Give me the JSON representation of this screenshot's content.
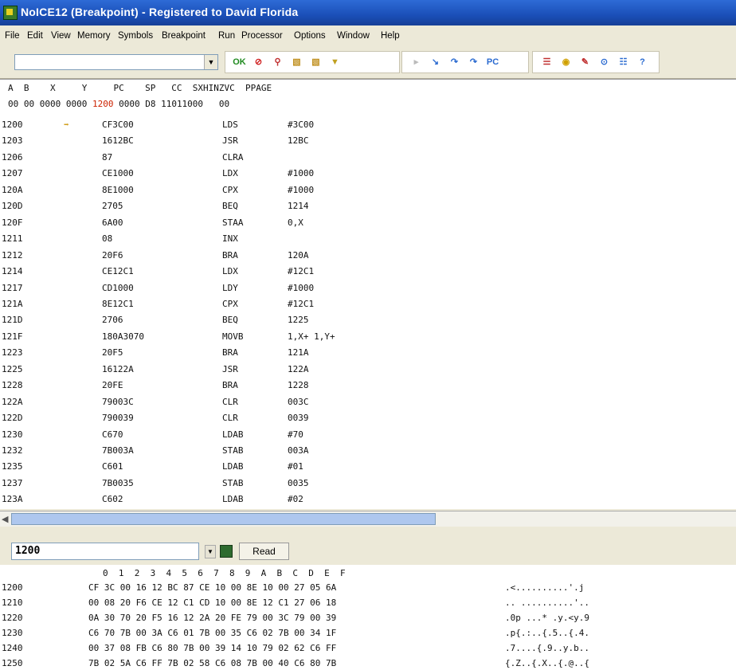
{
  "window": {
    "title": "NoICE12 (Breakpoint) - Registered to David Florida"
  },
  "menu": [
    "File",
    "Edit",
    "View",
    "Memory",
    "Symbols",
    "Breakpoint",
    "Run",
    "Processor",
    "Options",
    "Window",
    "Help"
  ],
  "toolbar": {
    "combo_value": "",
    "buttons": [
      {
        "name": "ok-button",
        "glyph": "OK",
        "color": "#1f8a1f"
      },
      {
        "name": "stop-button",
        "glyph": "⊘",
        "color": "#d02020"
      },
      {
        "name": "pin-button",
        "glyph": "⚲",
        "color": "#c03030"
      },
      {
        "name": "load-button",
        "glyph": "▧",
        "color": "#c09020"
      },
      {
        "name": "load-symbols-button",
        "glyph": "▧",
        "color": "#c09020"
      },
      {
        "name": "filter-button",
        "glyph": "▼",
        "color": "#c0a020"
      },
      {
        "name": "disabled-button",
        "glyph": "▸",
        "color": "#bbbbbb"
      },
      {
        "name": "step-into-button",
        "glyph": "↘",
        "color": "#2a6ad0"
      },
      {
        "name": "step-over-button",
        "glyph": "↷",
        "color": "#2a6ad0"
      },
      {
        "name": "run-to-button",
        "glyph": "↷",
        "color": "#2a6ad0"
      },
      {
        "name": "pc-button",
        "glyph": "PC",
        "color": "#2a6ad0"
      },
      {
        "name": "list-button",
        "glyph": "☰",
        "color": "#c03030"
      },
      {
        "name": "breakpoint-button",
        "glyph": "◉",
        "color": "#d0a000"
      },
      {
        "name": "edit-button",
        "glyph": "✎",
        "color": "#c03030"
      },
      {
        "name": "watch-button",
        "glyph": "⊙",
        "color": "#2a6ad0"
      },
      {
        "name": "memory-list-button",
        "glyph": "☷",
        "color": "#2a6ad0"
      },
      {
        "name": "help-button",
        "glyph": "?",
        "color": "#2a6ad0"
      }
    ]
  },
  "registers": {
    "headers": "A  B    X     Y     PC    SP   CC  SXHINZVC  PPAGE",
    "values_before": "00 00 0000 0000 ",
    "pc": "1200",
    "values_after": " 0000 D8 11011000   00",
    "pc_color": "#cc2200"
  },
  "disassembly": [
    {
      "addr": "1200",
      "bytes": "CF3C00",
      "op": "LDS",
      "arg": "#3C00",
      "current": true
    },
    {
      "addr": "1203",
      "bytes": "1612BC",
      "op": "JSR",
      "arg": "12BC"
    },
    {
      "addr": "1206",
      "bytes": "87",
      "op": "CLRA",
      "arg": ""
    },
    {
      "addr": "1207",
      "bytes": "CE1000",
      "op": "LDX",
      "arg": "#1000"
    },
    {
      "addr": "120A",
      "bytes": "8E1000",
      "op": "CPX",
      "arg": "#1000"
    },
    {
      "addr": "120D",
      "bytes": "2705",
      "op": "BEQ",
      "arg": "1214"
    },
    {
      "addr": "120F",
      "bytes": "6A00",
      "op": "STAA",
      "arg": "0,X"
    },
    {
      "addr": "1211",
      "bytes": "08",
      "op": "INX",
      "arg": ""
    },
    {
      "addr": "1212",
      "bytes": "20F6",
      "op": "BRA",
      "arg": "120A"
    },
    {
      "addr": "1214",
      "bytes": "CE12C1",
      "op": "LDX",
      "arg": "#12C1"
    },
    {
      "addr": "1217",
      "bytes": "CD1000",
      "op": "LDY",
      "arg": "#1000"
    },
    {
      "addr": "121A",
      "bytes": "8E12C1",
      "op": "CPX",
      "arg": "#12C1"
    },
    {
      "addr": "121D",
      "bytes": "2706",
      "op": "BEQ",
      "arg": "1225"
    },
    {
      "addr": "121F",
      "bytes": "180A3070",
      "op": "MOVB",
      "arg": "1,X+ 1,Y+"
    },
    {
      "addr": "1223",
      "bytes": "20F5",
      "op": "BRA",
      "arg": "121A"
    },
    {
      "addr": "1225",
      "bytes": "16122A",
      "op": "JSR",
      "arg": "122A"
    },
    {
      "addr": "1228",
      "bytes": "20FE",
      "op": "BRA",
      "arg": "1228"
    },
    {
      "addr": "122A",
      "bytes": "79003C",
      "op": "CLR",
      "arg": "003C"
    },
    {
      "addr": "122D",
      "bytes": "790039",
      "op": "CLR",
      "arg": "0039"
    },
    {
      "addr": "1230",
      "bytes": "C670",
      "op": "LDAB",
      "arg": "#70"
    },
    {
      "addr": "1232",
      "bytes": "7B003A",
      "op": "STAB",
      "arg": "003A"
    },
    {
      "addr": "1235",
      "bytes": "C601",
      "op": "LDAB",
      "arg": "#01"
    },
    {
      "addr": "1237",
      "bytes": "7B0035",
      "op": "STAB",
      "arg": "0035"
    },
    {
      "addr": "123A",
      "bytes": "C602",
      "op": "LDAB",
      "arg": "#02"
    }
  ],
  "memory": {
    "address_value": "1200",
    "read_label": "Read",
    "column_header": "0  1  2  3  4  5  6  7  8  9  A  B  C  D  E  F",
    "rows": [
      {
        "addr": "1200",
        "hex": "CF 3C 00 16 12 BC 87 CE 10 00 8E 10 00 27 05 6A",
        "ascii": ".<..........'.j"
      },
      {
        "addr": "1210",
        "hex": "00 08 20 F6 CE 12 C1 CD 10 00 8E 12 C1 27 06 18",
        "ascii": ".. ..........'.."
      },
      {
        "addr": "1220",
        "hex": "0A 30 70 20 F5 16 12 2A 20 FE 79 00 3C 79 00 39",
        "ascii": ".0p ...* .y.<y.9"
      },
      {
        "addr": "1230",
        "hex": "C6 70 7B 00 3A C6 01 7B 00 35 C6 02 7B 00 34 1F",
        "ascii": ".p{.:..{.5..{.4."
      },
      {
        "addr": "1240",
        "hex": "00 37 08 FB C6 80 7B 00 39 14 10 79 02 62 C6 FF",
        "ascii": ".7....{.9..y.b.."
      },
      {
        "addr": "1250",
        "hex": "7B 02 5A C6 FF 7B 02 58 C6 08 7B 00 40 C6 80 7B",
        "ascii": "{.Z..{.X..{.@..{"
      }
    ]
  }
}
